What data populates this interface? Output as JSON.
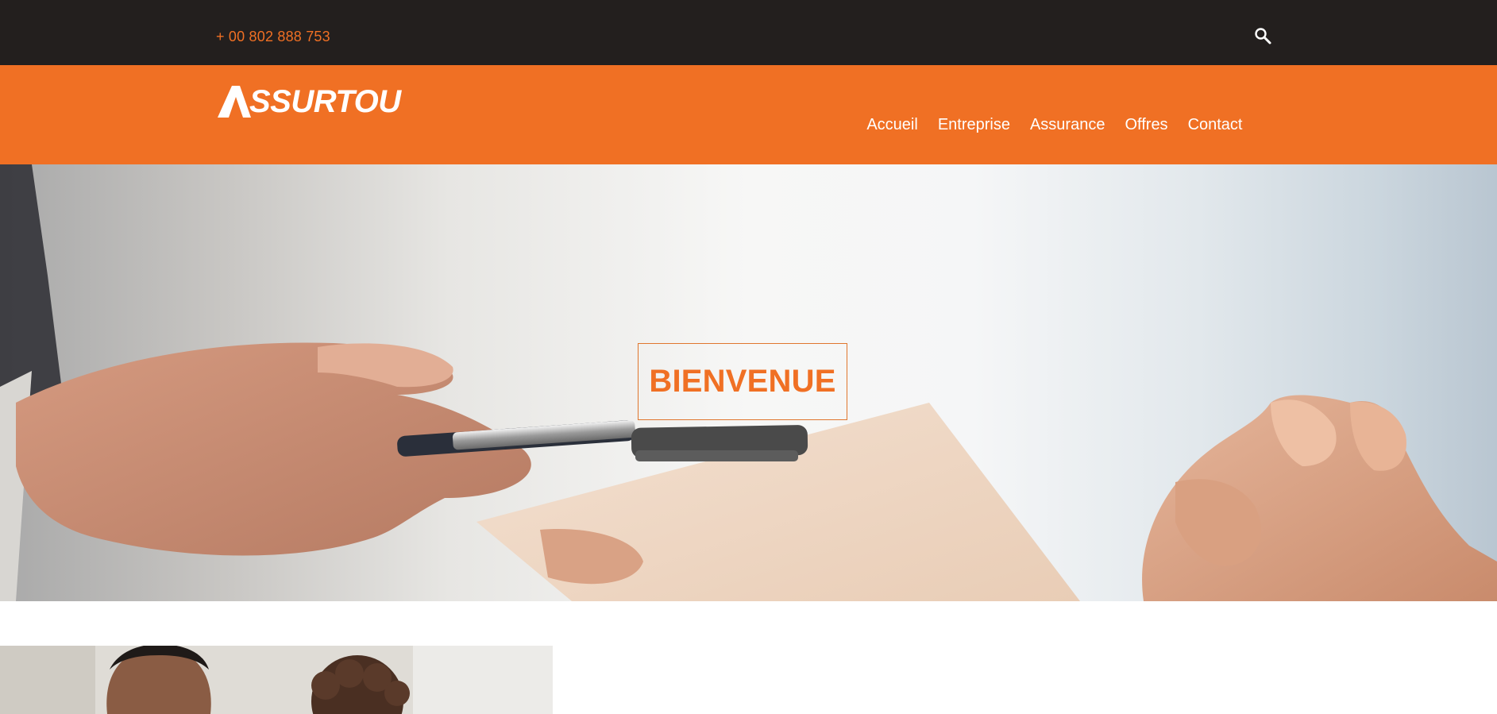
{
  "topbar": {
    "phone": "+ 00 802 888 753",
    "search_icon": "search-icon"
  },
  "header": {
    "logo_text": "SSURTOU",
    "logo_icon": "triangle-a-logo"
  },
  "nav": {
    "items": [
      {
        "label": "Accueil"
      },
      {
        "label": "Entreprise"
      },
      {
        "label": "Assurance"
      },
      {
        "label": "Offres"
      },
      {
        "label": "Contact"
      }
    ]
  },
  "hero": {
    "title": "BIENVENUE"
  },
  "colors": {
    "accent": "#f07024",
    "topbar_bg": "#231f1e",
    "text_light": "#ffffff"
  }
}
